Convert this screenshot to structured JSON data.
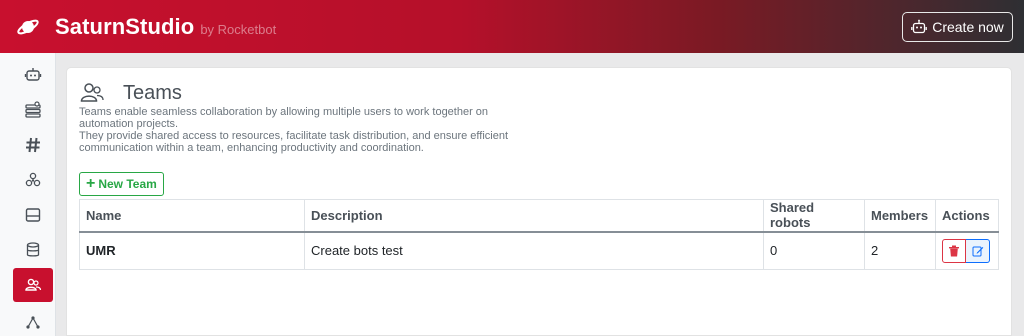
{
  "header": {
    "brand": "SaturnStudio",
    "byline": "by Rocketbot",
    "create_label": "Create now"
  },
  "sidebar": {
    "items": [
      {
        "icon": "robot-icon"
      },
      {
        "icon": "tool-icon"
      },
      {
        "icon": "hash-icon"
      },
      {
        "icon": "network-icon"
      },
      {
        "icon": "inbox-icon"
      },
      {
        "icon": "database-icon"
      },
      {
        "icon": "teams-icon",
        "active": true
      },
      {
        "icon": "diagram-icon"
      }
    ]
  },
  "page": {
    "title": "Teams",
    "description_lines": [
      "Teams enable seamless collaboration by allowing multiple users to work together on",
      "automation projects.",
      "They provide shared access to resources, facilitate task distribution, and ensure efficient",
      "communication within a team, enhancing productivity and coordination."
    ],
    "new_team_label": "New Team"
  },
  "table": {
    "headers": [
      "Name",
      "Description",
      "Shared robots",
      "Members",
      "Actions"
    ],
    "rows": [
      {
        "name": "UMR",
        "description": "Create bots test",
        "shared_robots": "0",
        "members": "2"
      }
    ]
  },
  "colors": {
    "brand_red": "#c8102e",
    "success": "#28a745",
    "danger": "#dc3545",
    "primary": "#0d6efd"
  }
}
